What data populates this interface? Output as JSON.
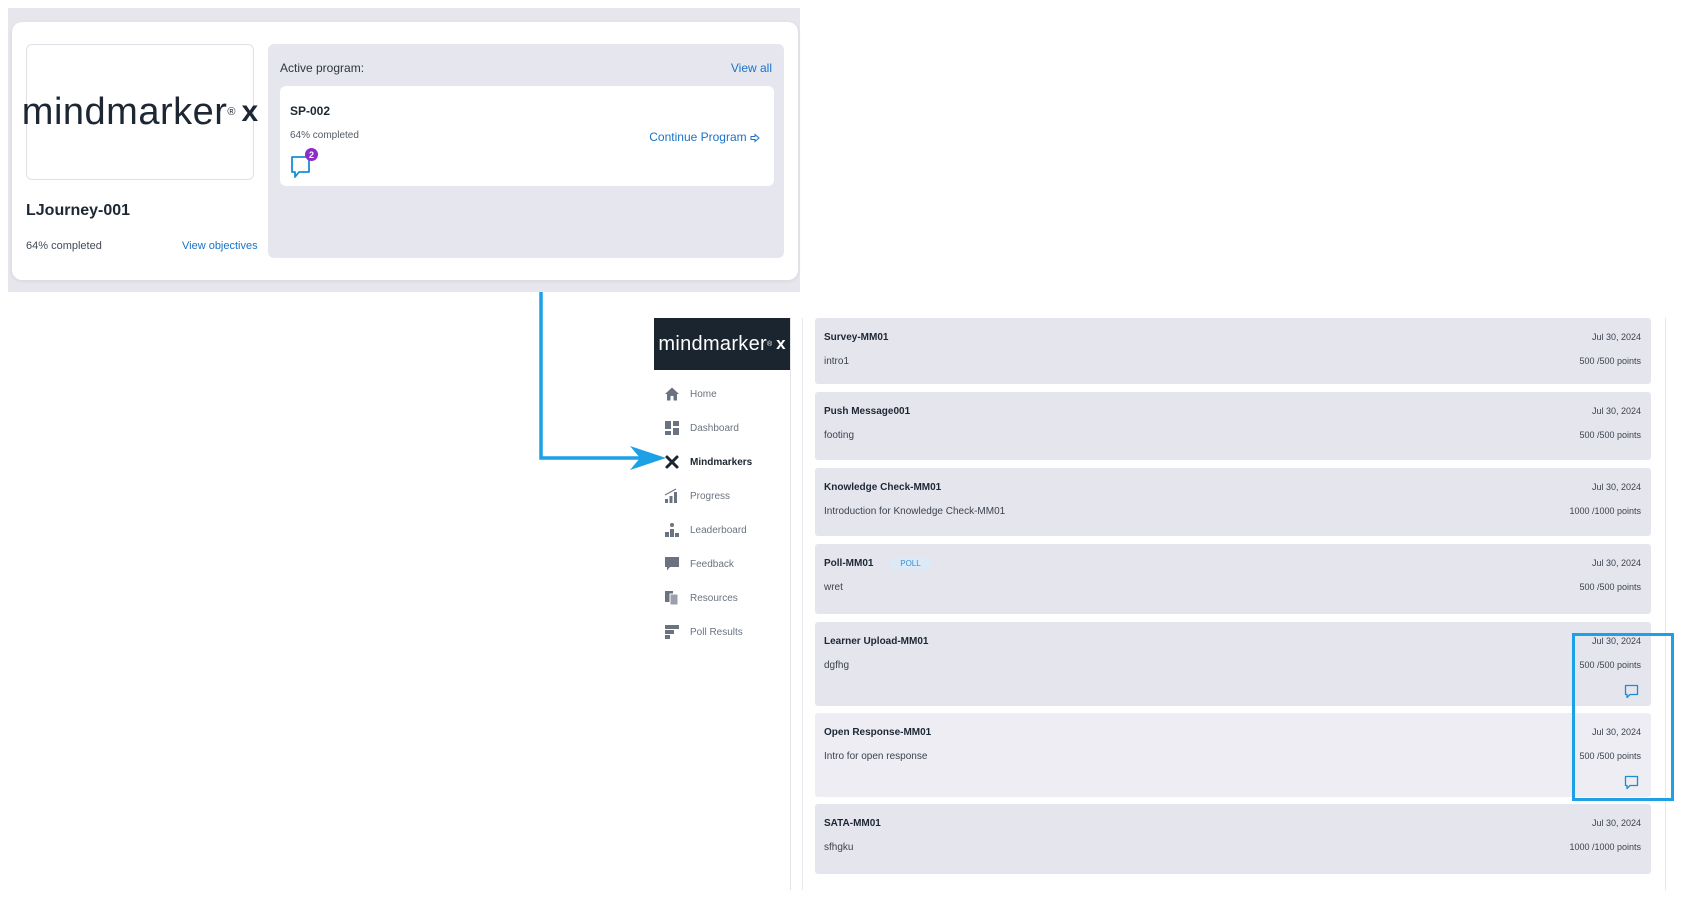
{
  "top_card": {
    "logo": {
      "word": "mindmarker",
      "reg": "®",
      "x": "x"
    },
    "journey_title": "LJourney-001",
    "journey_progress": "64% completed",
    "view_objectives": "View objectives",
    "active_program_label": "Active program:",
    "view_all": "View all",
    "program": {
      "name": "SP-002",
      "progress": "64% completed",
      "continue_label": "Continue Program",
      "comment_count": "2"
    }
  },
  "app": {
    "sidebar_logo": {
      "word": "mindmarker",
      "reg": "®",
      "x": "x"
    },
    "nav": [
      {
        "label": "Home",
        "icon": "home-icon",
        "active": false
      },
      {
        "label": "Dashboard",
        "icon": "dashboard-icon",
        "active": false
      },
      {
        "label": "Mindmarkers",
        "icon": "x-icon",
        "active": true
      },
      {
        "label": "Progress",
        "icon": "progress-icon",
        "active": false
      },
      {
        "label": "Leaderboard",
        "icon": "leaderboard-icon",
        "active": false
      },
      {
        "label": "Feedback",
        "icon": "feedback-icon",
        "active": false
      },
      {
        "label": "Resources",
        "icon": "resources-icon",
        "active": false
      },
      {
        "label": "Poll Results",
        "icon": "poll-results-icon",
        "active": false
      }
    ],
    "mindmarkers": [
      {
        "title": "Survey-MM01",
        "desc": "intro1",
        "date": "Jul 30, 2024",
        "points": "500 /500 points",
        "badge": "",
        "chat": false
      },
      {
        "title": "Push Message001",
        "desc": "footing",
        "date": "Jul 30, 2024",
        "points": "500 /500 points",
        "badge": "",
        "chat": false
      },
      {
        "title": "Knowledge Check-MM01",
        "desc": "Introduction for Knowledge Check-MM01",
        "date": "Jul 30, 2024",
        "points": "1000 /1000 points",
        "badge": "",
        "chat": false
      },
      {
        "title": "Poll-MM01",
        "desc": "wret",
        "date": "Jul 30, 2024",
        "points": "500 /500 points",
        "badge": "POLL",
        "chat": false
      },
      {
        "title": "Learner Upload-MM01",
        "desc": "dgfhg",
        "date": "Jul 30, 2024",
        "points": "500 /500 points",
        "badge": "",
        "chat": true
      },
      {
        "title": "Open Response-MM01",
        "desc": "Intro for open response",
        "date": "Jul 30, 2024",
        "points": "500 /500 points",
        "badge": "",
        "chat": true
      },
      {
        "title": "SATA-MM01",
        "desc": "sfhgku",
        "date": "Jul 30, 2024",
        "points": "1000 /1000 points",
        "badge": "",
        "chat": false
      }
    ]
  },
  "colors": {
    "accent": "#1a73c9",
    "highlight": "#1da1e6",
    "badge": "#8e2bc9",
    "sidebar_logo_bg": "#1b2530",
    "card_bg": "#e5e5ee"
  }
}
